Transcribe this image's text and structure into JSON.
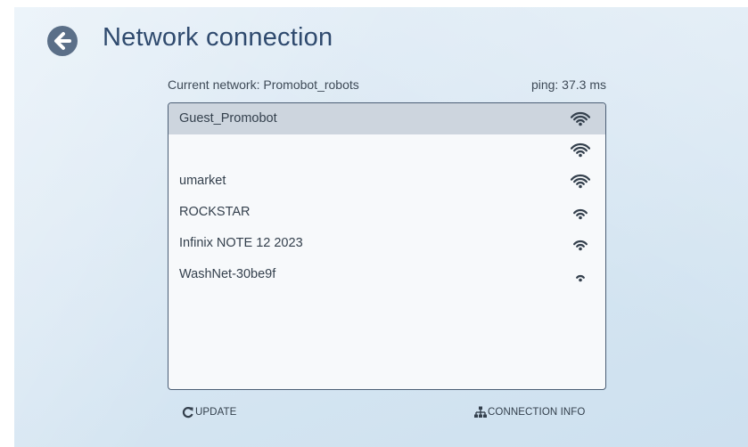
{
  "header": {
    "title": "Network connection",
    "back_icon": "arrow-left-circle-icon"
  },
  "status": {
    "current_network": "Current network: Promobot_robots",
    "ping": "ping: 37.3 ms"
  },
  "networks": [
    {
      "name": "Guest_Promobot",
      "signal": 4,
      "selected": true
    },
    {
      "name": "",
      "signal": 4,
      "selected": false
    },
    {
      "name": "umarket",
      "signal": 4,
      "selected": false
    },
    {
      "name": "ROCKSTAR",
      "signal": 3,
      "selected": false
    },
    {
      "name": "Infinix NOTE 12 2023",
      "signal": 3,
      "selected": false
    },
    {
      "name": "WashNet-30be9f",
      "signal": 2,
      "selected": false
    }
  ],
  "footer": {
    "update_label": "UPDATE",
    "update_icon": "refresh-icon",
    "connection_info_label": "CONNECTION INFO",
    "connection_info_icon": "network-tree-icon"
  },
  "colors": {
    "title": "#2f4a6e",
    "back_button": "#5b6f88",
    "list_border": "#4b5e75",
    "selected_row": "#cdd5de"
  }
}
